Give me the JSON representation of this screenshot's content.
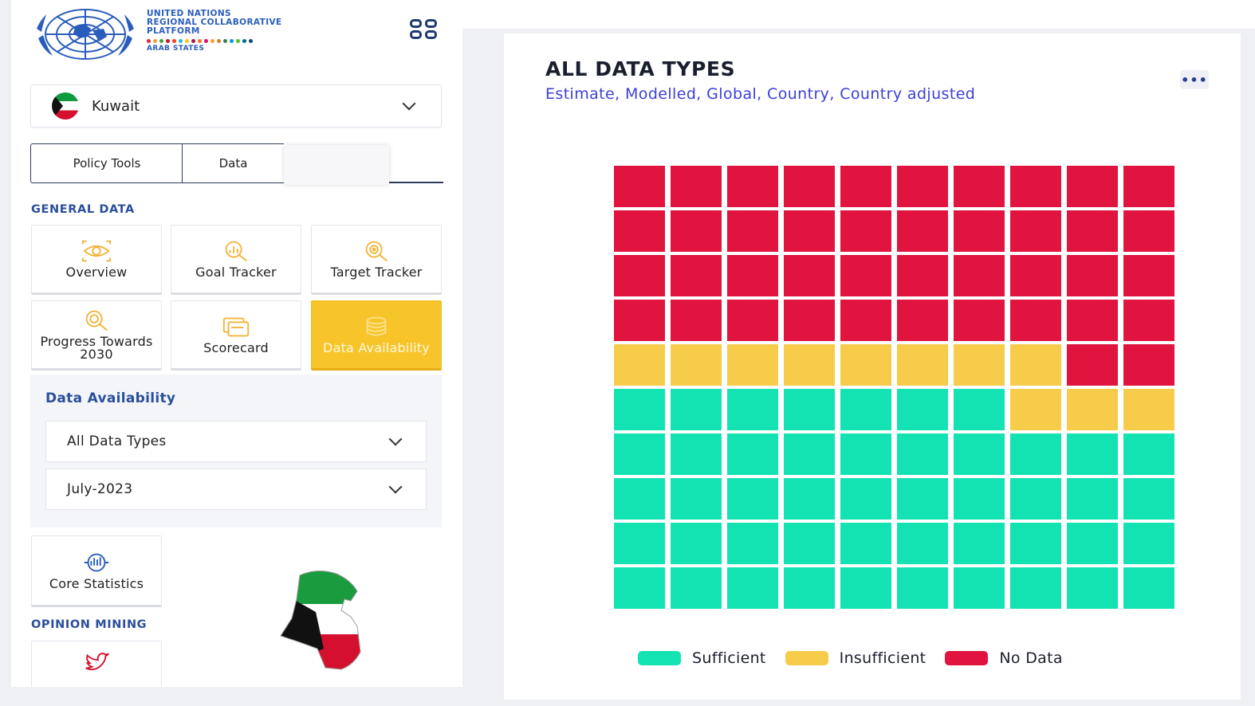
{
  "header": {
    "org_line1": "UNITED NATIONS",
    "org_line2": "REGIONAL COLLABORATIVE",
    "org_line3": "PLATFORM",
    "org_line4": "ARAB STATES"
  },
  "country_select": {
    "value": "Kuwait"
  },
  "tabs": [
    {
      "label": "Policy Tools"
    },
    {
      "label": "Data"
    }
  ],
  "sidebar": {
    "general_data_label": "GENERAL DATA",
    "tiles": [
      {
        "label": "Overview",
        "icon": "eye-icon"
      },
      {
        "label": "Goal Tracker",
        "icon": "chart-magnifier-icon"
      },
      {
        "label": "Target Tracker",
        "icon": "target-magnifier-icon"
      },
      {
        "label": "Progress Towards 2030",
        "icon": "progress-magnifier-icon"
      },
      {
        "label": "Scorecard",
        "icon": "scorecard-icon"
      },
      {
        "label": "Data Availability",
        "icon": "database-icon",
        "active": true
      }
    ],
    "data_availability": {
      "title": "Data Availability",
      "type_value": "All Data Types",
      "date_value": "July-2023"
    },
    "core_statistics_label": "Core Statistics",
    "opinion_mining_label": "OPINION MINING"
  },
  "main": {
    "title": "ALL DATA TYPES",
    "subtitle": "Estimate, Modelled, Global, Country, Country adjusted",
    "more_label": "•••"
  },
  "colors": {
    "sufficient": "#13e3b3",
    "insufficient": "#f7cc4a",
    "no_data": "#e0143f",
    "accent": "#2a4f9b",
    "active_tile": "#f7c52a"
  },
  "chart_data": {
    "type": "waffle",
    "grid": {
      "rows": 10,
      "cols": 10
    },
    "categories": [
      "Sufficient",
      "Insufficient",
      "No Data"
    ],
    "values": [
      47,
      11,
      42
    ],
    "legend_position": "bottom"
  }
}
